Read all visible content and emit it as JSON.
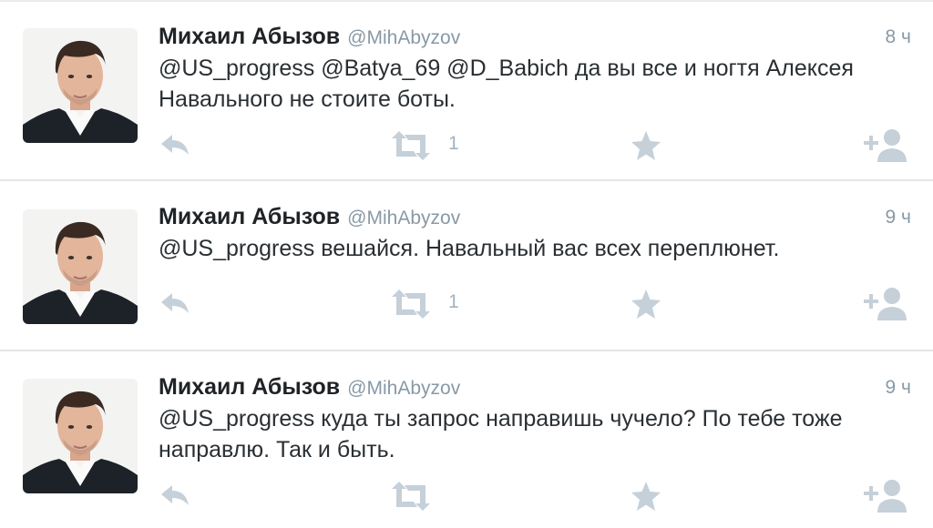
{
  "tweets": [
    {
      "name": "Михаил Абызов",
      "handle": "@MihAbyzov",
      "time": "8 ч",
      "text": "@US_progress @Batya_69 @D_Babich да вы все и ногтя Алексея Навального не стоите боты.",
      "retweet_count": "1"
    },
    {
      "name": "Михаил Абызов",
      "handle": "@MihAbyzov",
      "time": "9 ч",
      "text": "@US_progress вешайся. Навальный вас всех переплюнет.",
      "retweet_count": "1"
    },
    {
      "name": "Михаил Абызов",
      "handle": "@MihAbyzov",
      "time": "9 ч",
      "text": "@US_progress куда ты запрос направишь чучело? По тебе тоже направлю. Так и быть.",
      "retweet_count": ""
    }
  ],
  "icons": {
    "reply": "reply-icon",
    "retweet": "retweet-icon",
    "favorite": "star-icon",
    "follow": "follow-user-icon"
  },
  "colors": {
    "name": "#1f2326",
    "handle": "#8899a6",
    "text": "#292f33",
    "action_icon": "#c5d0d9",
    "separator": "#e3e6e8"
  }
}
